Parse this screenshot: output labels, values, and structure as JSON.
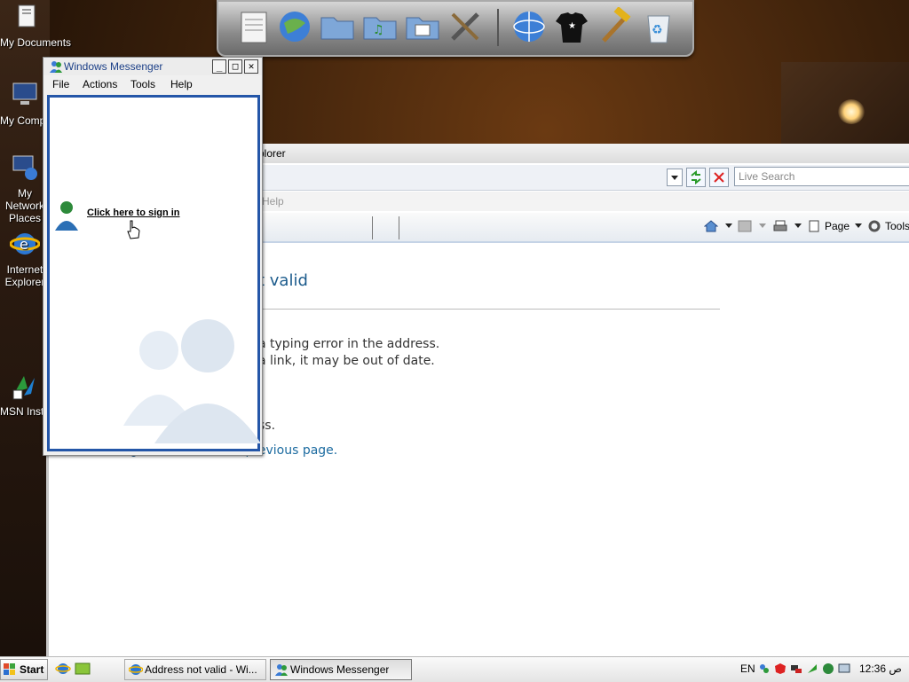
{
  "desktop": {
    "icons": [
      {
        "label": "My Documents"
      },
      {
        "label": "My Computer"
      },
      {
        "label": "My Network Places"
      },
      {
        "label": "Internet Explorer"
      },
      {
        "label": "MSN Installer"
      }
    ]
  },
  "dock": {
    "items": [
      "notepad-icon",
      "globe-icon",
      "folder-icon",
      "music-folder-icon",
      "picture-folder-icon",
      "tools-icon",
      "network-globe-icon",
      "tshirt-icon",
      "hammer-icon",
      "recycle-bin-icon"
    ]
  },
  "ie": {
    "title_fragment": "plorer",
    "search_placeholder": "Live Search",
    "menu_fragment": "Help",
    "toolbar": {
      "page_label": "Page",
      "tools_label": "Tools"
    },
    "content": {
      "title_fragment": "t valid",
      "line1": "a typing error in the address.",
      "line2": "a link, it may be out of date.",
      "line3": "ss.",
      "back_link": "Go back to the previous page."
    }
  },
  "messenger": {
    "title": "Windows Messenger",
    "menu": [
      "File",
      "Actions",
      "Tools",
      "Help"
    ],
    "signin_text": "Click here to sign in"
  },
  "taskbar": {
    "start_label": "Start",
    "tasks": [
      {
        "label": "Address not valid - Wi...",
        "active": false
      },
      {
        "label": "Windows Messenger",
        "active": true
      }
    ],
    "lang": "EN",
    "clock": "12:36 ص"
  },
  "colors": {
    "accent": "#2456a8",
    "link": "#1c6ba0",
    "messenger_title": "#1b3f87"
  }
}
